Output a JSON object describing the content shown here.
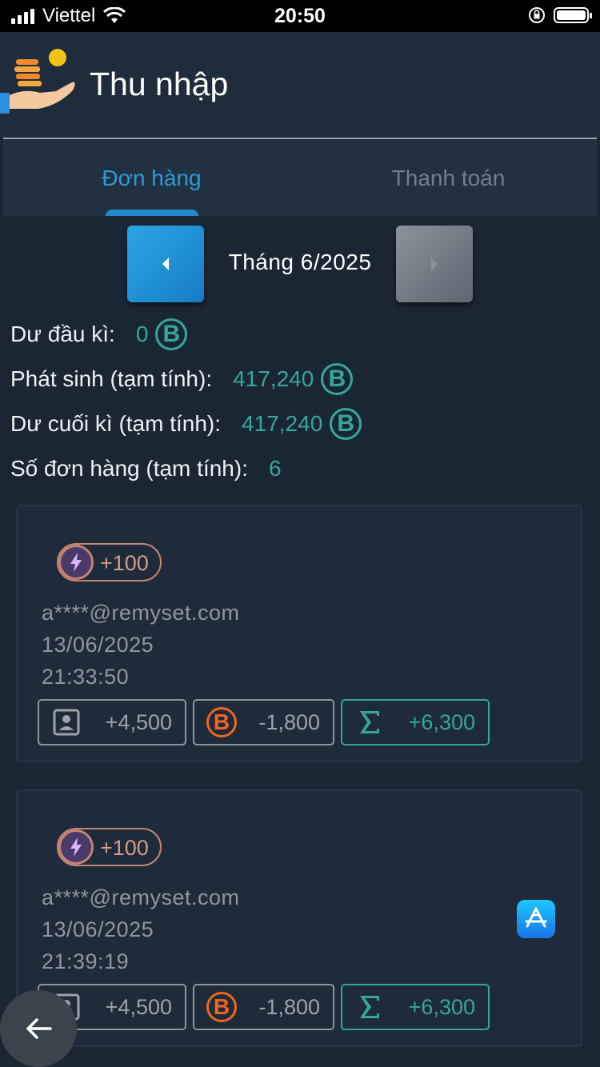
{
  "status_bar": {
    "carrier": "Viettel",
    "time": "20:50"
  },
  "header": {
    "title": "Thu nhập"
  },
  "tabs": [
    {
      "label": "Đơn hàng",
      "active": true
    },
    {
      "label": "Thanh toán",
      "active": false
    }
  ],
  "month_nav": {
    "label": "Tháng 6/2025",
    "prev_icon": "chevron-left-icon",
    "next_icon": "chevron-right-icon"
  },
  "summary": {
    "opening": {
      "label": "Dư đầu kì:",
      "value": "0",
      "coin": "B"
    },
    "incurred": {
      "label": "Phát sinh (tạm tính):",
      "value": "417,240",
      "coin": "B"
    },
    "closing": {
      "label": "Dư cuối kì (tạm tính):",
      "value": "417,240",
      "coin": "B"
    },
    "orders": {
      "label": "Số đơn hàng (tạm tính):",
      "value": "6"
    }
  },
  "orders": [
    {
      "bonus": "+100",
      "email": "a****@remyset.com",
      "date": "13/06/2025",
      "time": "21:33:50",
      "amounts": {
        "user": "+4,500",
        "coin": "-1,800",
        "total": "+6,300"
      },
      "coin_letter": "B",
      "has_app_store": false
    },
    {
      "bonus": "+100",
      "email": "a****@remyset.com",
      "date": "13/06/2025",
      "time": "21:39:19",
      "amounts": {
        "user": "+4,500",
        "coin": "-1,800",
        "total": "+6,300"
      },
      "coin_letter": "B",
      "has_app_store": true
    }
  ],
  "colors": {
    "accent": "#2d9ad6",
    "teal": "#35a79a",
    "orange": "#f0661f",
    "background": "#1b2634"
  }
}
